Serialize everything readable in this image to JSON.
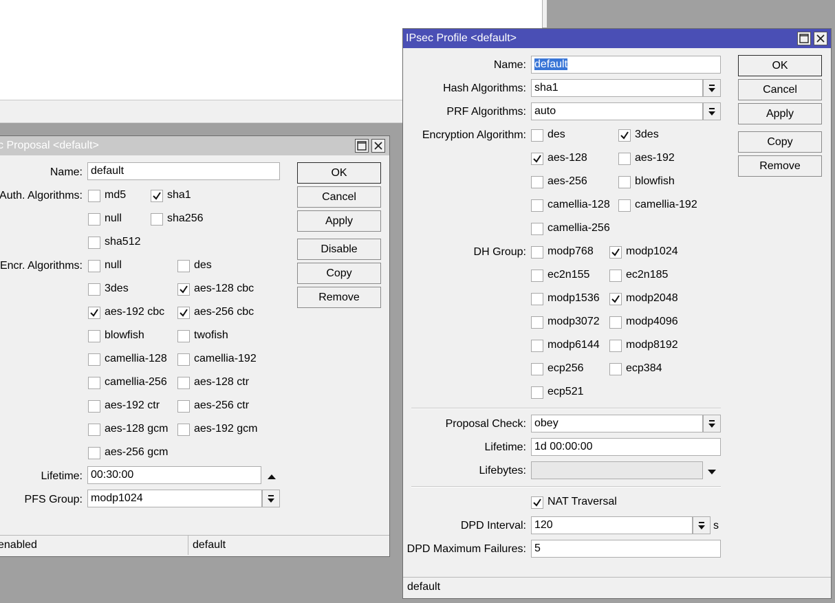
{
  "proposal": {
    "title": "IPsec Proposal <default>",
    "name_label": "Name:",
    "name": "default",
    "auth_label": "Auth. Algorithms:",
    "auth": [
      {
        "label": "md5",
        "checked": false
      },
      {
        "label": "sha1",
        "checked": true
      },
      {
        "label": "null",
        "checked": false
      },
      {
        "label": "sha256",
        "checked": false
      },
      {
        "label": "sha512",
        "checked": false
      }
    ],
    "encr_label": "Encr. Algorithms:",
    "encr": [
      {
        "label": "null",
        "checked": false
      },
      {
        "label": "des",
        "checked": false
      },
      {
        "label": "3des",
        "checked": false
      },
      {
        "label": "aes-128 cbc",
        "checked": true
      },
      {
        "label": "aes-192 cbc",
        "checked": true
      },
      {
        "label": "aes-256 cbc",
        "checked": true
      },
      {
        "label": "blowfish",
        "checked": false
      },
      {
        "label": "twofish",
        "checked": false
      },
      {
        "label": "camellia-128",
        "checked": false
      },
      {
        "label": "camellia-192",
        "checked": false
      },
      {
        "label": "camellia-256",
        "checked": false
      },
      {
        "label": "aes-128 ctr",
        "checked": false
      },
      {
        "label": "aes-192 ctr",
        "checked": false
      },
      {
        "label": "aes-256 ctr",
        "checked": false
      },
      {
        "label": "aes-128 gcm",
        "checked": false
      },
      {
        "label": "aes-192 gcm",
        "checked": false
      },
      {
        "label": "aes-256 gcm",
        "checked": false
      }
    ],
    "lifetime_label": "Lifetime:",
    "lifetime": "00:30:00",
    "pfs_label": "PFS Group:",
    "pfs": "modp1024",
    "buttons": {
      "ok": "OK",
      "cancel": "Cancel",
      "apply": "Apply",
      "disable": "Disable",
      "copy": "Copy",
      "remove": "Remove"
    },
    "status": {
      "state": "enabled",
      "name": "default"
    }
  },
  "profile": {
    "title": "IPsec Profile <default>",
    "name_label": "Name:",
    "name": "default",
    "hash_label": "Hash Algorithms:",
    "hash": "sha1",
    "prf_label": "PRF Algorithms:",
    "prf": "auto",
    "enc_label": "Encryption Algorithm:",
    "enc": [
      {
        "label": "des",
        "checked": false
      },
      {
        "label": "3des",
        "checked": true
      },
      {
        "label": "aes-128",
        "checked": true
      },
      {
        "label": "aes-192",
        "checked": false
      },
      {
        "label": "aes-256",
        "checked": false
      },
      {
        "label": "blowfish",
        "checked": false
      },
      {
        "label": "camellia-128",
        "checked": false
      },
      {
        "label": "camellia-192",
        "checked": false
      },
      {
        "label": "camellia-256",
        "checked": false
      }
    ],
    "dh_label": "DH Group:",
    "dh": [
      {
        "label": "modp768",
        "checked": false
      },
      {
        "label": "modp1024",
        "checked": true
      },
      {
        "label": "ec2n155",
        "checked": false
      },
      {
        "label": "ec2n185",
        "checked": false
      },
      {
        "label": "modp1536",
        "checked": false
      },
      {
        "label": "modp2048",
        "checked": true
      },
      {
        "label": "modp3072",
        "checked": false
      },
      {
        "label": "modp4096",
        "checked": false
      },
      {
        "label": "modp6144",
        "checked": false
      },
      {
        "label": "modp8192",
        "checked": false
      },
      {
        "label": "ecp256",
        "checked": false
      },
      {
        "label": "ecp384",
        "checked": false
      },
      {
        "label": "ecp521",
        "checked": false
      }
    ],
    "proposal_check_label": "Proposal Check:",
    "proposal_check": "obey",
    "lifetime_label": "Lifetime:",
    "lifetime": "1d 00:00:00",
    "lifebytes_label": "Lifebytes:",
    "lifebytes": "",
    "nat": {
      "label": "NAT Traversal",
      "checked": true
    },
    "dpd_interval_label": "DPD Interval:",
    "dpd_interval": "120",
    "dpd_unit": "s",
    "dpd_max_label": "DPD Maximum Failures:",
    "dpd_max": "5",
    "buttons": {
      "ok": "OK",
      "cancel": "Cancel",
      "apply": "Apply",
      "copy": "Copy",
      "remove": "Remove"
    },
    "status": {
      "name": "default"
    }
  },
  "colors": {
    "title_active": "#4a4fb5",
    "title_inactive": "#c9c9c9",
    "selection": "#3875d7"
  }
}
